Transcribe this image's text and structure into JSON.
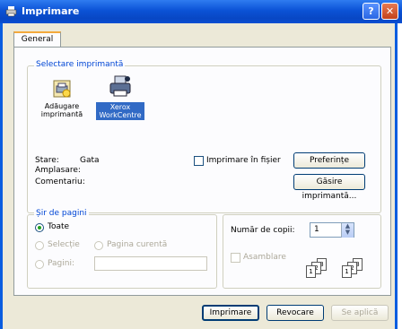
{
  "window": {
    "title": "Imprimare",
    "help_glyph": "?",
    "close_glyph": "✕"
  },
  "tabs": [
    {
      "label": "General"
    }
  ],
  "printer_group": {
    "title": "Selectare imprimantă",
    "printers": [
      {
        "label_line1": "Adăugare",
        "label_line2": "imprimantă",
        "icon": "add-printer-icon"
      },
      {
        "label_line1": "Xerox",
        "label_line2": "WorkCentre",
        "icon": "printer-icon",
        "selected": true
      }
    ]
  },
  "status": {
    "state_label": "Stare:",
    "state_value": "Gata",
    "location_label": "Amplasare:",
    "comment_label": "Comentariu:",
    "print_to_file_label": "Imprimare în fișier",
    "preferences_button": "Preferințe",
    "find_printer_button": "Găsire imprimantă..."
  },
  "page_range": {
    "title": "Șir de pagini",
    "all_label": "Toate",
    "selection_label": "Selecție",
    "current_page_label": "Pagina curentă",
    "pages_label": "Pagini:",
    "pages_value": ""
  },
  "copies": {
    "label": "Număr de copii:",
    "value": "1",
    "collate_label": "Asamblare",
    "collate_icons": [
      "1",
      "2",
      "3",
      "1",
      "2",
      "3"
    ]
  },
  "footer": {
    "print_button": "Imprimare",
    "cancel_button": "Revocare",
    "apply_button": "Se aplică"
  },
  "colors": {
    "title_bar": "#0b52d6",
    "group_title": "#0046d5",
    "selection": "#316ac5"
  }
}
